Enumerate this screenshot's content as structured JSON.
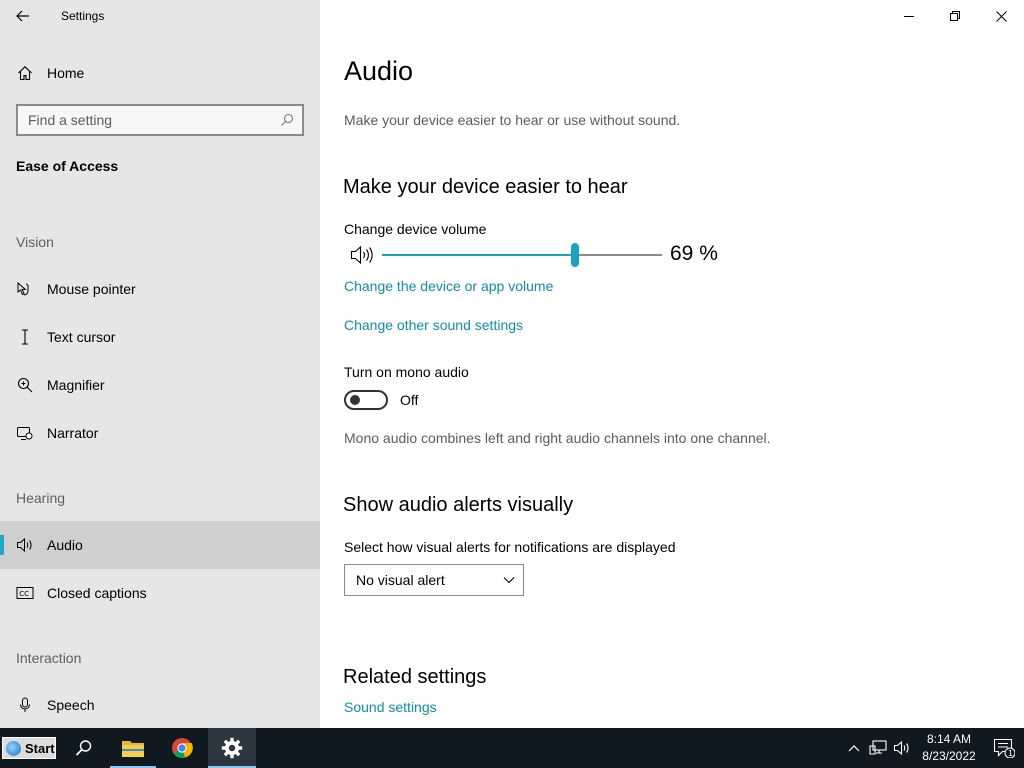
{
  "window": {
    "app_title": "Settings"
  },
  "sidebar": {
    "home_label": "Home",
    "search_placeholder": "Find a setting",
    "section_title": "Ease of Access",
    "groups": {
      "vision": "Vision",
      "hearing": "Hearing",
      "interaction": "Interaction"
    },
    "items": {
      "mouse_pointer": "Mouse pointer",
      "text_cursor": "Text cursor",
      "magnifier": "Magnifier",
      "narrator": "Narrator",
      "audio": "Audio",
      "closed_captions": "Closed captions",
      "speech": "Speech"
    },
    "selected_item": "Audio",
    "accent_color": "#22a8c0"
  },
  "main": {
    "title": "Audio",
    "subtitle": "Make your device easier to hear or use without sound.",
    "hear_section": {
      "heading": "Make your device easier to hear",
      "volume_label": "Change device volume",
      "volume_value": 69,
      "volume_text": "69 %",
      "link_device_app_volume": "Change the device or app volume",
      "link_other_sound": "Change other sound settings",
      "mono_label": "Turn on mono audio",
      "mono_state": "Off",
      "mono_description": "Mono audio combines left and right audio channels into one channel."
    },
    "alerts_section": {
      "heading": "Show audio alerts visually",
      "select_label": "Select how visual alerts for notifications are displayed",
      "selected_option": "No visual alert"
    },
    "related_section": {
      "heading": "Related settings",
      "link_sound_settings": "Sound settings"
    },
    "link_color": "#0f8ea6"
  },
  "taskbar": {
    "start_label": "Start",
    "time": "8:14 AM",
    "date": "8/23/2022",
    "notification_count": "1",
    "icons": [
      "search-icon",
      "file-explorer-icon",
      "chrome-icon",
      "settings-icon"
    ]
  }
}
